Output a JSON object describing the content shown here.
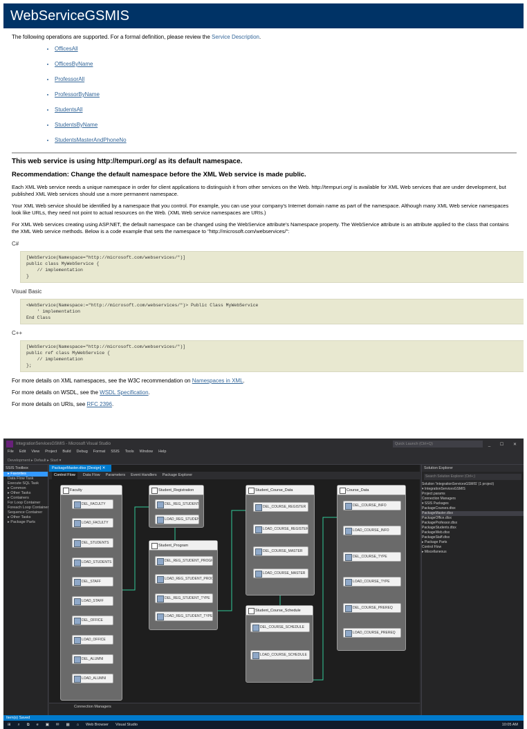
{
  "web": {
    "title": "WebServiceGSMIS",
    "intro_text": "The following operations are supported. For a formal definition, please review the ",
    "intro_link": "Service Description",
    "operations": [
      "OfficesAll",
      "OfficesByName",
      "ProfessorAll",
      "ProfessorByName",
      "StudentsAll",
      "StudentsByName",
      "StudentsMasterAndPhoneNo"
    ],
    "ns_title": "This web service is using http://tempuri.org/ as its default namespace.",
    "ns_recommendation": "Recommendation: Change the default namespace before the XML Web service is made public.",
    "para1": "Each XML Web service needs a unique namespace in order for client applications to distinguish it from other services on the Web. http://tempuri.org/ is available for XML Web services that are under development, but published XML Web services should use a more permanent namespace.",
    "para2": "Your XML Web service should be identified by a namespace that you control. For example, you can use your company's Internet domain name as part of the namespace. Although many XML Web service namespaces look like URLs, they need not point to actual resources on the Web. (XML Web service namespaces are URIs.)",
    "para3": "For XML Web services creating using ASP.NET, the default namespace can be changed using the WebService attribute's Namespace property. The WebService attribute is an attribute applied to the class that contains the XML Web service methods. Below is a code example that sets the namespace to \"http://microsoft.com/webservices/\":",
    "lang_csharp": "C#",
    "code_csharp": "[WebService(Namespace=\"http://microsoft.com/webservices/\")]\npublic class MyWebService {\n    // implementation\n}",
    "lang_vb": "Visual Basic",
    "code_vb": "<WebService(Namespace:=\"http://microsoft.com/webservices/\")> Public Class MyWebService\n    ' implementation\nEnd Class",
    "lang_cpp": "C++",
    "code_cpp": "[WebService(Namespace=\"http://microsoft.com/webservices/\")]\npublic ref class MyWebService {\n    // implementation\n};",
    "more1_text": "For more details on XML namespaces, see the W3C recommendation on ",
    "more1_link": "Namespaces in XML",
    "more2_text": "For more details on WSDL, see the ",
    "more2_link": "WSDL Specification",
    "more3_text": "For more details on URIs, see ",
    "more3_link": "RFC 2396"
  },
  "vs": {
    "title": "IntegrationServicesGSMIS - Microsoft Visual Studio",
    "quick_launch": "Quick Launch (Ctrl+Q)",
    "window_buttons": "_ ☐ ✕",
    "menu": [
      "File",
      "Edit",
      "View",
      "Project",
      "Build",
      "Debug",
      "Format",
      "SSIS",
      "Tools",
      "Window",
      "Help"
    ],
    "toolbar_text": "Development  ▸ Default  ▸ Start ▾",
    "ssis_toolbox_title": "SSIS Toolbox",
    "toolbox_items": [
      "▸ Favorites",
      "  Data Flow Task",
      "  Execute SQL Task",
      "▸ Common",
      "▸ Other Tasks",
      "▸ Containers",
      "  For Loop Container",
      "  Foreach Loop Container",
      "  Sequence Container",
      "▸ Other Tasks",
      "▸ Package Parts"
    ],
    "doc_tab": "PackageMaster.dtsx [Design] ✕",
    "designer_tabs": [
      "Control Flow",
      "Data Flow",
      "Parameters",
      "Event Handlers",
      "Package Explorer"
    ],
    "containers": [
      {
        "title": "Faculty",
        "tasks": [
          "DEL_FACULTY",
          "LOAD_FACULTY",
          "DEL_STUDENTS",
          "LOAD_STUDENTS",
          "DEL_STAFF",
          "LOAD_STAFF",
          "DEL_OFFICE",
          "LOAD_OFFICE",
          "DEL_ALUMNI",
          "LOAD_ALUMNI"
        ]
      },
      {
        "title": "Student_Registration",
        "tasks": [
          "DEL_REG_STUDENT_TYPE",
          "LOAD_REG_STUDENT_TYPE"
        ]
      },
      {
        "title": "Student_Program",
        "tasks": [
          "DEL_REG_STUDENT_PROGRAM",
          "LOAD_REG_STUDENT_PROGRAM",
          "DEL_REG_STUDENT_TYPE",
          "LOAD_REG_STUDENT_TYPE"
        ]
      },
      {
        "title": "Student_Course_Data",
        "tasks": [
          "DEL_COURSE_REGISTER",
          "LOAD_COURSE_REGISTER",
          "DEL_COURSE_MASTER",
          "LOAD_COURSE_MASTER"
        ]
      },
      {
        "title": "Student_Course_Schedule",
        "tasks": [
          "DEL_COURSE_SCHEDULE",
          "LOAD_COURSE_SCHEDULE"
        ]
      },
      {
        "title": "Course_Data",
        "tasks": [
          "DEL_COURSE_INFO",
          "LOAD_COURSE_INFO",
          "DEL_COURSE_TYPE",
          "LOAD_COURSE_TYPE",
          "DEL_COURSE_PREREQ",
          "LOAD_COURSE_PREREQ"
        ]
      }
    ],
    "connection_managers": "Connection Managers",
    "solution_title": "Solution Explorer",
    "solution_search": "Search Solution Explorer (Ctrl+;)",
    "solution_items": [
      "Solution 'IntegrationServicesGSMIS' (1 project)",
      "▾ IntegrationServicesGSMIS",
      "  Project.params",
      "  Connection Managers",
      "▾ SSIS Packages",
      "    PackageCourses.dtsx",
      "    PackageMaster.dtsx",
      "    PackageOffice.dtsx",
      "    PackageProfessor.dtsx",
      "    PackageStudents.dtsx",
      "    PackageWeb.dtsx",
      "    PackageStaff.dtsx",
      "▸ Package Parts",
      "    Control Flow",
      "▸ Miscellaneous"
    ],
    "status": "Item(s) Saved",
    "taskbar_items": [
      "⊞",
      "⌕",
      "⧉",
      "e",
      "▣",
      "✉",
      "▦",
      "⌂",
      "Web Browser",
      "Visual Studio"
    ],
    "clock": "10:05 AM"
  }
}
